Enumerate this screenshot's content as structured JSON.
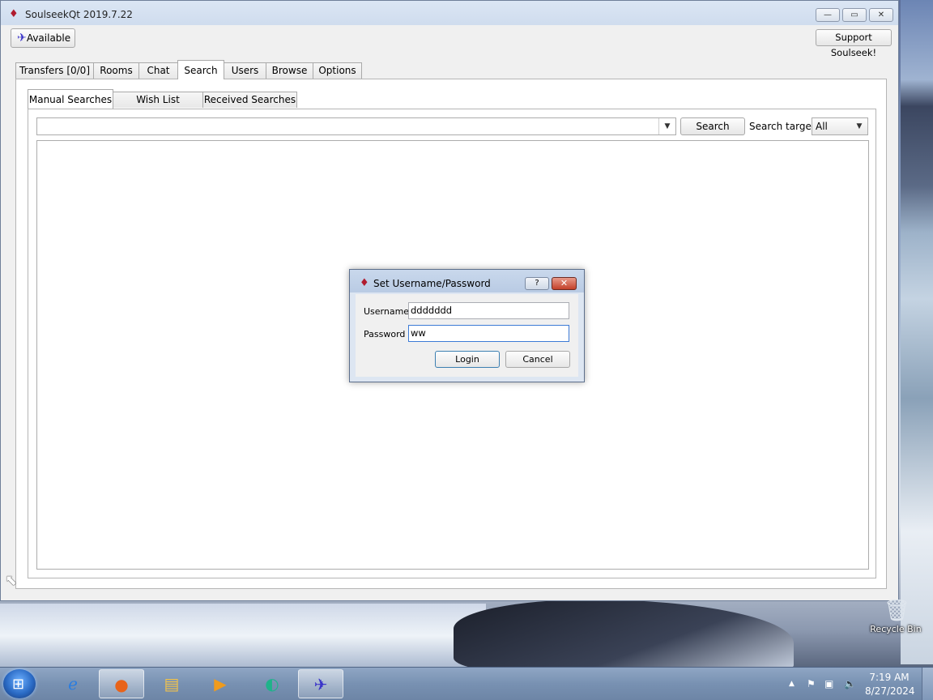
{
  "window": {
    "title": "SoulseekQt 2019.7.22",
    "minimize": "—",
    "maximize": "▭",
    "close": "✕"
  },
  "toolbar": {
    "status_label": "Available",
    "support_label": "Support Soulseek!"
  },
  "main_tabs": [
    {
      "label": "Transfers [0/0]"
    },
    {
      "label": "Rooms"
    },
    {
      "label": "Chat"
    },
    {
      "label": "Search",
      "active": true
    },
    {
      "label": "Users"
    },
    {
      "label": "Browse"
    },
    {
      "label": "Options"
    }
  ],
  "search_tabs": [
    {
      "label": "Manual Searches",
      "active": true
    },
    {
      "label": "Wish List Searches"
    },
    {
      "label": "Received Searches"
    }
  ],
  "search": {
    "query": "",
    "button_label": "Search",
    "target_label": "Search target:",
    "target_value": "All"
  },
  "dialog": {
    "title": "Set Username/Password",
    "help": "?",
    "close": "✕",
    "username_label": "Username",
    "username_value": "ddddddd",
    "password_label": "Password",
    "password_value": "ww",
    "login_label": "Login",
    "cancel_label": "Cancel"
  },
  "desktop": {
    "recycle_bin_label": "Recycle Bin"
  },
  "taskbar": {
    "time": "7:19 AM",
    "date": "8/27/2024",
    "items": [
      "internet-explorer",
      "firefox",
      "file-explorer",
      "media-player",
      "chat-app",
      "soulseek"
    ]
  },
  "colors": {
    "accent": "#3d7bd6",
    "close_red": "#c3402a",
    "soulseek_bird": "#3b35c9"
  }
}
